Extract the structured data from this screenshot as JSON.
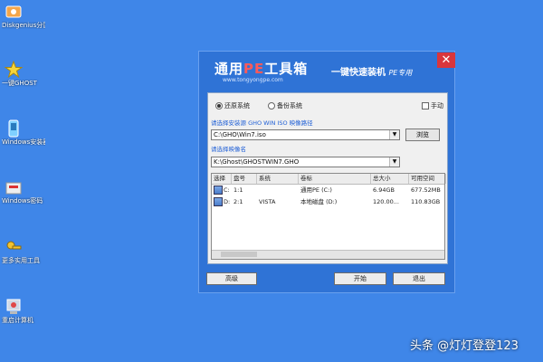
{
  "desktop": {
    "icons": [
      {
        "label": "Diskgenius分区工具",
        "icon": "disk-tool-icon"
      },
      {
        "label": "一键GHOST",
        "icon": "star-icon"
      },
      {
        "label": "Windows安装器",
        "icon": "installer-icon"
      },
      {
        "label": "Windows密码",
        "icon": "password-icon"
      },
      {
        "label": "更多实用工具",
        "icon": "key-icon"
      },
      {
        "label": "重启计算机",
        "icon": "restart-icon"
      }
    ]
  },
  "dialog": {
    "brand_main_1": "通用",
    "brand_main_pe": "PE",
    "brand_main_2": "工具箱",
    "brand_url": "www.tongyongpe.com",
    "slogan": "一键快速装机",
    "slogan_sub": "PE专用",
    "close_label": "✕",
    "radio_restore": "还原系统",
    "radio_backup": "备份系统",
    "check_manual": "手动",
    "hint_image": "请选择安装源 GHO WIN ISO 映像路径",
    "image_path": "C:\\GHO\\Win7.iso",
    "browse_label": "浏览",
    "hint_file": "请选择映像名",
    "file_path": "K:\\Ghost\\GHOSTWIN7.GHO",
    "table": {
      "headers": [
        "选择",
        "盘号",
        "系统",
        "卷标",
        "总大小",
        "可用空间"
      ],
      "rows": [
        {
          "drive": "C:",
          "num": "1:1",
          "sys": "",
          "label": "通用PE (C:)",
          "size": "6.94GB",
          "free": "677.52MB"
        },
        {
          "drive": "D:",
          "num": "2:1",
          "sys": "VISTA",
          "label": "本地磁盘 (D:)",
          "size": "120.00...",
          "free": "110.83GB"
        }
      ]
    },
    "btn_advanced": "高级",
    "btn_start": "开始",
    "btn_exit": "退出"
  },
  "watermark": "头条 @灯灯登登123",
  "colors": {
    "desktop": "#3f86e8",
    "dialog": "#2f73d6",
    "close": "#d9363c",
    "accent_pe": "#ff5a5a"
  }
}
